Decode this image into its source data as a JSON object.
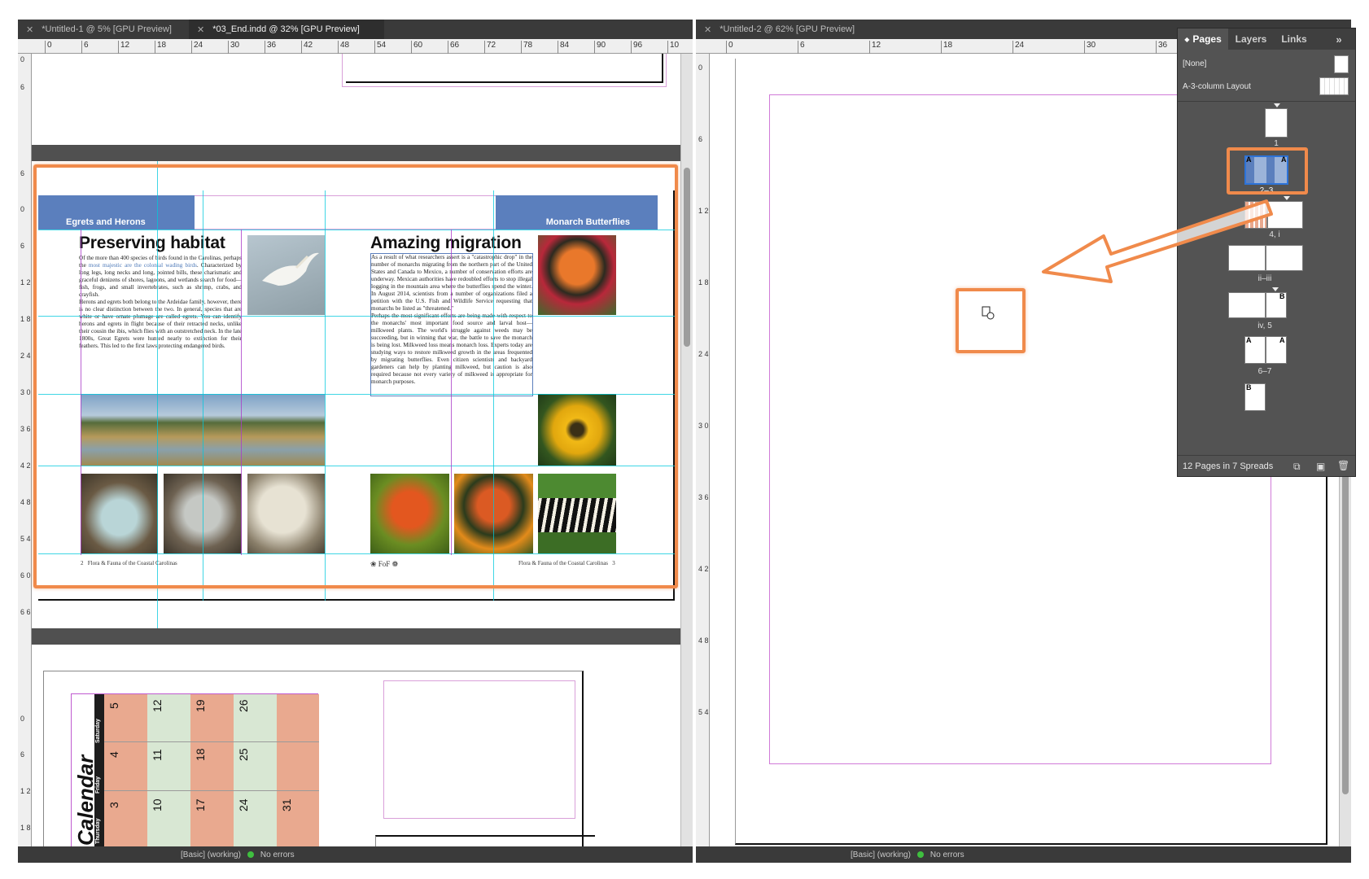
{
  "left_window": {
    "tabs": [
      {
        "label": "*Untitled-1 @ 5% [GPU Preview]",
        "active": false
      },
      {
        "label": "*03_End.indd @ 32% [GPU Preview]",
        "active": true
      }
    ],
    "ruler_h": [
      "0",
      "6",
      "12",
      "18",
      "24",
      "30",
      "36",
      "42",
      "48",
      "54",
      "60",
      "66",
      "72",
      "78",
      "84",
      "90",
      "96",
      "10"
    ],
    "ruler_v": [
      "0",
      "6",
      "6",
      "0",
      "6",
      "1 2",
      "1 8",
      "2 4",
      "3 0",
      "3 6",
      "4 2",
      "4 8",
      "5 4",
      "6 0",
      "6 6",
      "0",
      "6",
      "1 2",
      "1 8"
    ],
    "spread": {
      "left_band": "Egrets and Herons",
      "right_band": "Monarch Butterflies",
      "left_heading": "Preserving habitat",
      "right_heading": "Amazing migration",
      "left_body_p1_a": "Of the more than 400 species of birds found in the Carolinas, perhaps the ",
      "left_body_p1_link": "most majestic are the colonial wading birds",
      "left_body_p1_b": ". Characterized by long legs, long necks and long, pointed bills, these charismatic and graceful denizens of shores, lagoons, and wetlands search for food—fish, frogs, and small invertebrates, such as shrimp, crabs, and crayfish.",
      "left_body_p2": "Herons and egrets both belong to the Ardeidae family, however, there is no clear distinction between the two. In general, species that are white or have ornate plumage are called egrets. You can identify herons and egrets in flight because of their retracted necks, unlike their cousin the ibis, which flies with an outstretched neck. In the late 1800s, Great Egrets were hunted nearly to extinction for their feathers. This led to the first laws protecting endangered birds.",
      "right_body_p1": "As a result of what researchers assert is a \"catastrophic drop\" in the number of monarchs migrating from the northern part of the United States and Canada to Mexico, a number of conservation efforts are underway. Mexican authorities have redoubled efforts to stop illegal logging in the mountain area where the butterflies spend the winter. In August 2014, scientists from a number of organizations filed a petition with the U.S. Fish and Wildlife Service requesting that monarchs be listed as \"threatened.\"",
      "right_body_p2": "Perhaps the most significant efforts are being made with respect to the monarchs' most important food source and larval host—milkweed plants. The world's struggle against weeds may be succeeding, but in winning that war, the battle to save the monarch is being lost. Milkweed loss means monarch loss. Experts today are studying ways to restore milkweed growth in the areas frequented by migrating butterflies. Even citizen scientists and backyard gardeners can help by planting milkweed, but caution is also required because not every variety of milkweed is appropriate for monarch purposes.",
      "footer_left_num": "2",
      "footer_left_text": "Flora & Fauna of the Coastal Carolinas",
      "footer_logo": "FoF",
      "footer_right_text": "Flora & Fauna of the Coastal Carolinas",
      "footer_right_num": "3"
    },
    "calendar": {
      "title": "Calendar",
      "days": [
        "Thursday",
        "Friday",
        "Saturday"
      ],
      "rows": [
        [
          "3",
          "4",
          "5"
        ],
        [
          "10",
          "11",
          "12"
        ],
        [
          "17",
          "18",
          "19"
        ],
        [
          "24",
          "25",
          "26"
        ],
        [
          "31",
          "",
          ""
        ]
      ]
    },
    "status_text": "[Basic] (working)",
    "status_errors": "No errors"
  },
  "right_window": {
    "tab_label": "*Untitled-2 @ 62% [GPU Preview]",
    "ruler_h": [
      "0",
      "6",
      "12",
      "18",
      "24",
      "30",
      "36"
    ],
    "ruler_v": [
      "0",
      "6",
      "1 2",
      "1 8",
      "2 4",
      "3 0",
      "3 6",
      "4 2",
      "4 8",
      "5 4"
    ],
    "status_text": "[Basic] (working)",
    "status_errors": "No errors"
  },
  "pages_panel": {
    "tabs": [
      "Pages",
      "Layers",
      "Links"
    ],
    "active_tab": "Pages",
    "collapse_glyph": "»",
    "masters": [
      "[None]",
      "A-3-column Layout"
    ],
    "spreads": [
      {
        "label": "1"
      },
      {
        "label": "2–3",
        "selected": true
      },
      {
        "label": "4, i"
      },
      {
        "label": "ii–iii"
      },
      {
        "label": "iv, 5"
      },
      {
        "label": "6–7"
      },
      {
        "label": ""
      }
    ],
    "summary": "12 Pages in 7 Spreads"
  },
  "colors": {
    "highlight": "#f08a4b",
    "band": "#5b7fbd",
    "guide": "#00c8dc",
    "margin": "#c05ad0",
    "cal_salmon": "#e9a98f",
    "cal_green": "#d8e7d3"
  }
}
